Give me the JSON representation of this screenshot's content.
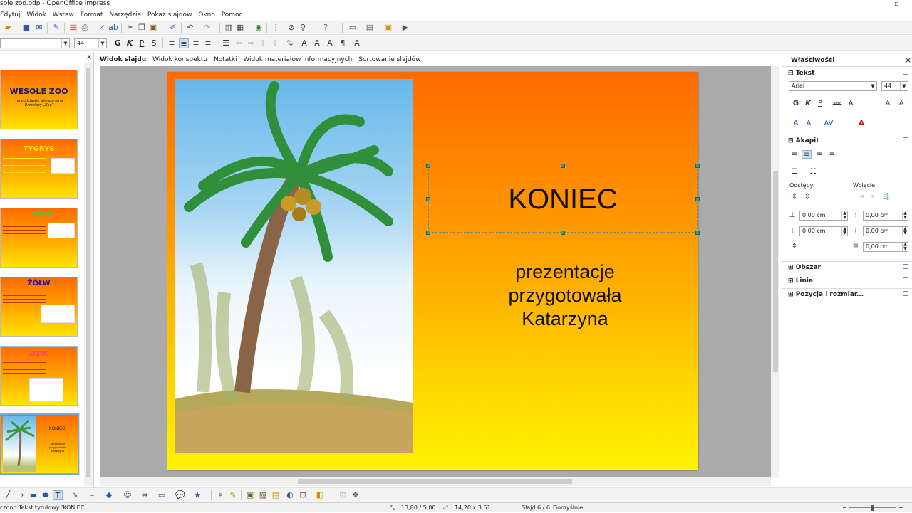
{
  "window": {
    "title": "sołe zoo.odp - OpenOffice Impress",
    "minimize": "–",
    "restore": "▫"
  },
  "menu": [
    "Edytuj",
    "Widok",
    "Wstaw",
    "Format",
    "Narzędzia",
    "Pokaz slajdów",
    "Okno",
    "Pomoc"
  ],
  "toolbar2": {
    "font_size": "44",
    "bold": "G",
    "italic": "K",
    "underline": "P",
    "shadow": "S"
  },
  "slide_pane": {
    "close": "×",
    "slides": [
      {
        "title": "WESOŁE ZOO",
        "subtitle": "na podstawie wiersza Jana Brzechwy „Zoo”",
        "color": "#1a1a6e"
      },
      {
        "title": "TYGRYS",
        "color": "#ffe600"
      },
      {
        "title": "WILK",
        "color": "#3ad13a"
      },
      {
        "title": "ŻÓŁW",
        "color": "#1a1a9e"
      },
      {
        "title": "DZIK",
        "color": "#ff3a8c"
      },
      {
        "title": "KONIEC",
        "subtitle": "prezentacje przygotowała Katarzyna"
      }
    ]
  },
  "view_tabs": [
    "Widok slajdu",
    "Widok konspektu",
    "Notatki",
    "Widok materiałów informacyjnych",
    "Sortowanie slajdów"
  ],
  "slide": {
    "title": "KONIEC",
    "subtitle_lines": [
      "prezentacje",
      "przygotowała",
      "Katarzyna"
    ]
  },
  "sidebar": {
    "title": "Właściwości",
    "close": "×",
    "text_section": "Tekst",
    "font_name": "Arial",
    "font_size": "44",
    "paragraph_section": "Akapit",
    "spacing_label": "Odstępy:",
    "indent_label": "Wcięcie:",
    "spacing_above": "0,00 cm",
    "spacing_below": "0,00 cm",
    "indent_before": "0,00 cm",
    "indent_after": "0,00 cm",
    "indent_first": "0,00 cm",
    "area_section": "Obszar",
    "line_section": "Linia",
    "position_section": "Pozycja i rozmiar..."
  },
  "status": {
    "selection": "czono Tekst tytułowy 'KONIEC'",
    "position": "13,80 / 5,00",
    "size": "14,20 x 3,51",
    "slide": "Slajd 6 / 6",
    "layout": "Domyślnie",
    "zoom_minus": "−",
    "zoom_plus": "+"
  }
}
